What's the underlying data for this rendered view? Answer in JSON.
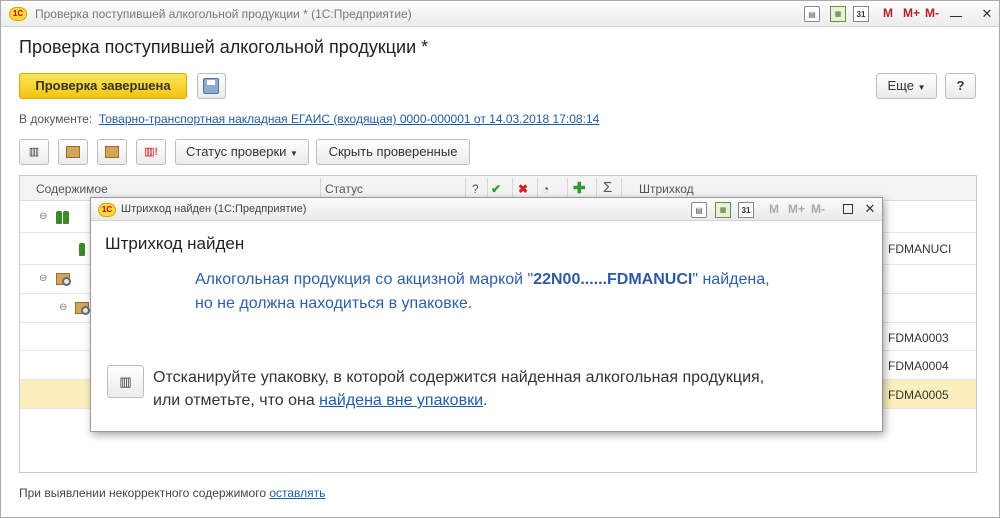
{
  "window": {
    "title": "Проверка поступившей алкогольной продукции * (1С:Предприятие)",
    "logo": "1С",
    "toolbar_icons": [
      "print-icon",
      "calculator-icon",
      "calendar-icon"
    ],
    "calendar_day": "31",
    "m_labels": {
      "m": "M",
      "mplus": "M+",
      "mminus": "M-"
    },
    "controls": {
      "minimize": "—",
      "close": "✕"
    }
  },
  "page": {
    "title": "Проверка поступившей алкогольной продукции *",
    "done_button": "Проверка завершена",
    "more_button": "Еще",
    "help_button": "?",
    "doc_label": "В документе:",
    "doc_link": "Товарно-транспортная накладная ЕГАИС (входящая) 0000-000001 от 14.03.2018 17:08:14",
    "status_button": "Статус проверки",
    "hide_checked_button": "Скрыть проверенные",
    "footer_text": "При выявлении некорректного содержимого",
    "footer_link": "оставлять"
  },
  "table": {
    "headers": {
      "content": "Содержимое",
      "status": "Статус",
      "q": "?",
      "barcode": "Штрихкод"
    },
    "header_icons": [
      "checkmark-icon",
      "cross-icon",
      "pie-icon",
      "plus-icon",
      "sigma-icon"
    ],
    "rows": [
      {
        "barcode": ""
      },
      {
        "barcode": "FDMANUCI"
      },
      {
        "barcode": ""
      },
      {
        "barcode": ""
      },
      {
        "barcode": "FDMA0003"
      },
      {
        "barcode": "FDMA0004"
      },
      {
        "barcode": "FDMA0005"
      }
    ]
  },
  "dialog": {
    "title": "Штрихкод найден  (1С:Предприятие)",
    "heading": "Штрихкод найден",
    "msg_part1": "Алкогольная продукция со акцизной маркой \"",
    "msg_code": "22N00......FDMANUCI",
    "msg_part2": "\" найдена,",
    "msg_line2": "но не должна   находиться в упаковке.",
    "scan_text": "Отсканируйте упаковку, в которой содержится найденная алкогольная продукция,",
    "line2_prefix": "или отметьте, что  она ",
    "line2_link": "найдена вне упаковки",
    "line2_suffix": "."
  },
  "colors": {
    "accent_yellow": "#f2c50e",
    "link": "#1f5ca8",
    "message_blue": "#2b5fa8",
    "selected_row": "#fbf0bd"
  }
}
